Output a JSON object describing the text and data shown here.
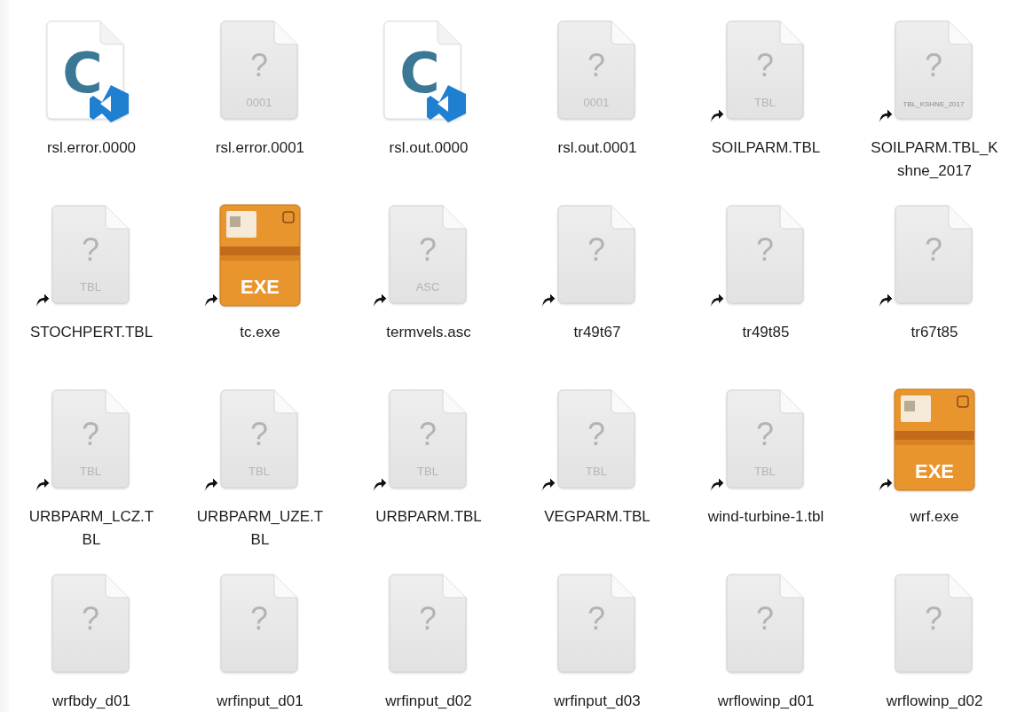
{
  "items": [
    {
      "name_lines": [
        "rsl.error.0000"
      ],
      "kind": "vscode",
      "glyph": "C",
      "alias": false
    },
    {
      "name_lines": [
        "rsl.error.0001"
      ],
      "kind": "unknown",
      "glyph": "?",
      "badge": "0001",
      "alias": false
    },
    {
      "name_lines": [
        "rsl.out.0000"
      ],
      "kind": "vscode",
      "glyph": "C",
      "alias": false
    },
    {
      "name_lines": [
        "rsl.out.0001"
      ],
      "kind": "unknown",
      "glyph": "?",
      "badge": "0001",
      "alias": false
    },
    {
      "name_lines": [
        "SOILPARM.TBL"
      ],
      "kind": "unknown",
      "glyph": "?",
      "badge": "TBL",
      "alias": true
    },
    {
      "name_lines": [
        "SOILPARM.TBL_K",
        "shne_2017"
      ],
      "kind": "unknown",
      "glyph": "?",
      "badge": "TBL_KSHNE_2017",
      "alias": true
    },
    {
      "name_lines": [
        "STOCHPERT.TBL"
      ],
      "kind": "unknown",
      "glyph": "?",
      "badge": "TBL",
      "alias": true
    },
    {
      "name_lines": [
        "tc.exe"
      ],
      "kind": "exe",
      "glyph": "EXE",
      "alias": true
    },
    {
      "name_lines": [
        "termvels.asc"
      ],
      "kind": "unknown",
      "glyph": "?",
      "badge": "ASC",
      "alias": true
    },
    {
      "name_lines": [
        "tr49t67"
      ],
      "kind": "unknown",
      "glyph": "?",
      "alias": true
    },
    {
      "name_lines": [
        "tr49t85"
      ],
      "kind": "unknown",
      "glyph": "?",
      "alias": true
    },
    {
      "name_lines": [
        "tr67t85"
      ],
      "kind": "unknown",
      "glyph": "?",
      "alias": true
    },
    {
      "name_lines": [
        "URBPARM_LCZ.T",
        "BL"
      ],
      "kind": "unknown",
      "glyph": "?",
      "badge": "TBL",
      "alias": true
    },
    {
      "name_lines": [
        "URBPARM_UZE.T",
        "BL"
      ],
      "kind": "unknown",
      "glyph": "?",
      "badge": "TBL",
      "alias": true
    },
    {
      "name_lines": [
        "URBPARM.TBL"
      ],
      "kind": "unknown",
      "glyph": "?",
      "badge": "TBL",
      "alias": true
    },
    {
      "name_lines": [
        "VEGPARM.TBL"
      ],
      "kind": "unknown",
      "glyph": "?",
      "badge": "TBL",
      "alias": true
    },
    {
      "name_lines": [
        "wind-turbine-1.tbl"
      ],
      "kind": "unknown",
      "glyph": "?",
      "badge": "TBL",
      "alias": true
    },
    {
      "name_lines": [
        "wrf.exe"
      ],
      "kind": "exe",
      "glyph": "EXE",
      "alias": true
    },
    {
      "name_lines": [
        "wrfbdy_d01"
      ],
      "kind": "unknown",
      "glyph": "?",
      "alias": false
    },
    {
      "name_lines": [
        "wrfinput_d01"
      ],
      "kind": "unknown",
      "glyph": "?",
      "alias": false
    },
    {
      "name_lines": [
        "wrfinput_d02"
      ],
      "kind": "unknown",
      "glyph": "?",
      "alias": false
    },
    {
      "name_lines": [
        "wrfinput_d03"
      ],
      "kind": "unknown",
      "glyph": "?",
      "alias": false
    },
    {
      "name_lines": [
        "wrflowinp_d01"
      ],
      "kind": "unknown",
      "glyph": "?",
      "alias": false
    },
    {
      "name_lines": [
        "wrflowinp_d02"
      ],
      "kind": "unknown",
      "glyph": "?",
      "alias": false
    }
  ]
}
